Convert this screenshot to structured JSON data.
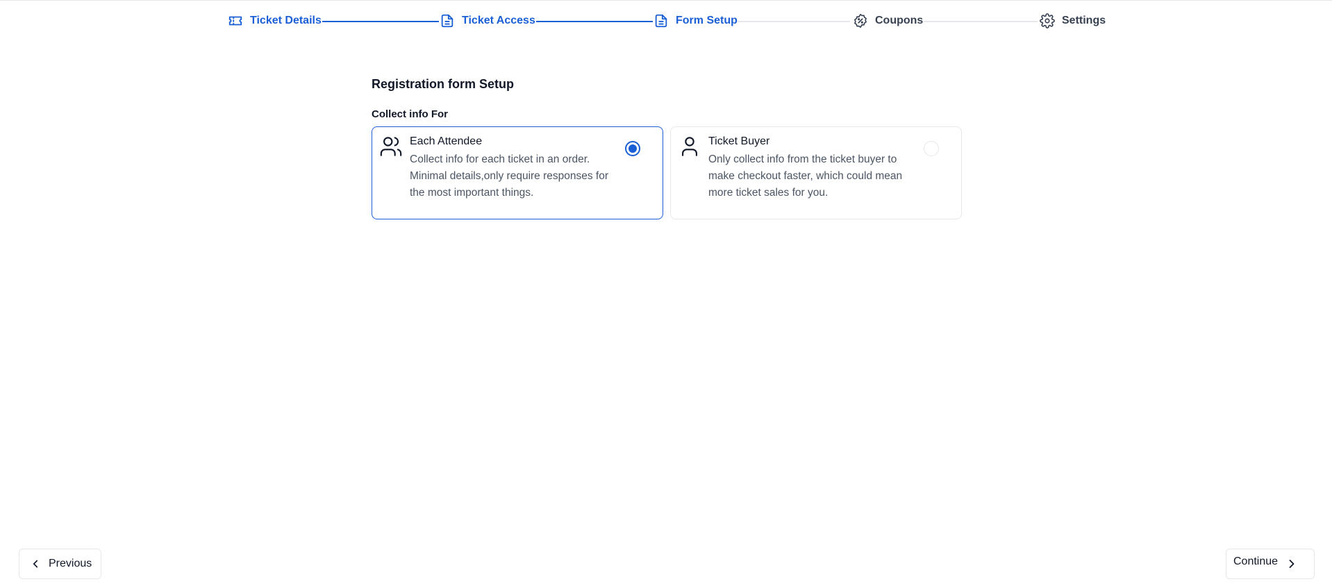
{
  "stepper": {
    "steps": [
      {
        "label": "Ticket Details",
        "icon": "ticket-icon",
        "state": "active"
      },
      {
        "label": "Ticket Access",
        "icon": "document-icon",
        "state": "active"
      },
      {
        "label": "Form Setup",
        "icon": "document-icon",
        "state": "active"
      },
      {
        "label": "Coupons",
        "icon": "discount-badge-icon",
        "state": "inactive"
      },
      {
        "label": "Settings",
        "icon": "gear-icon",
        "state": "inactive"
      }
    ]
  },
  "form": {
    "title": "Registration form Setup",
    "collect_label": "Collect info For",
    "options": [
      {
        "title": "Each Attendee",
        "description": "Collect info for each ticket in an order. Minimal details,only require responses for the most important things.",
        "icon": "users-icon",
        "selected": true
      },
      {
        "title": "Ticket Buyer",
        "description": "Only collect info from the ticket buyer to make checkout faster, which could mean more ticket sales for you.",
        "icon": "user-icon",
        "selected": false
      }
    ]
  },
  "footer": {
    "previous_label": "Previous",
    "continue_label": "Continue"
  },
  "colors": {
    "accent": "#1a5fd6",
    "muted_border": "#e5e7eb",
    "text_primary": "#111827",
    "text_secondary": "#4b5563"
  }
}
